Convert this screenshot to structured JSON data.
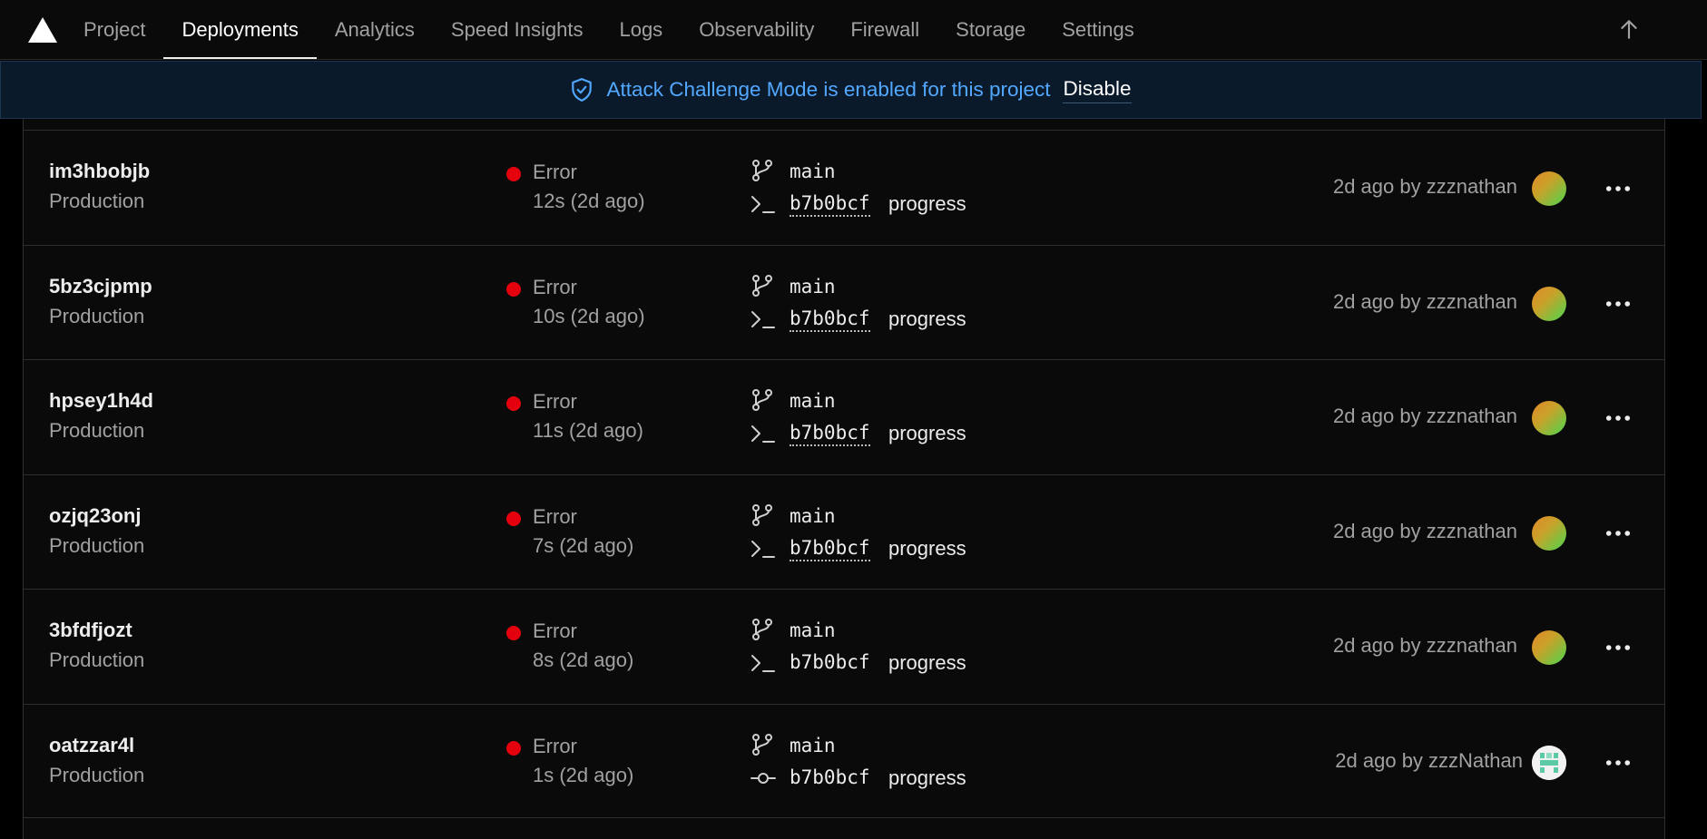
{
  "nav": {
    "tabs": [
      {
        "label": "Project"
      },
      {
        "label": "Deployments"
      },
      {
        "label": "Analytics"
      },
      {
        "label": "Speed Insights"
      },
      {
        "label": "Logs"
      },
      {
        "label": "Observability"
      },
      {
        "label": "Firewall"
      },
      {
        "label": "Storage"
      },
      {
        "label": "Settings"
      }
    ],
    "active_tab": "Deployments",
    "logo_icon": "vercel-triangle-icon",
    "up_icon": "arrow-up-icon"
  },
  "banner": {
    "message": "Attack Challenge Mode is enabled for this project",
    "action": "Disable",
    "icon": "shield-check-icon",
    "accent_color": "#52a8ff"
  },
  "colors": {
    "error_dot": "#e5000e",
    "background": "#0a0a0a",
    "border": "#2e2e2e",
    "muted_text": "#a1a1a1"
  },
  "deployments": [
    {
      "id": "im3hbobjb",
      "env": "Production",
      "status": "Error",
      "duration": "12s (2d ago)",
      "branch": "main",
      "commit": "b7b0bcf",
      "commit_msg": "progress",
      "commit_icon": "terminal-icon",
      "meta": "2d ago by zzznathan",
      "avatar": "gradient-avatar"
    },
    {
      "id": "5bz3cjpmp",
      "env": "Production",
      "status": "Error",
      "duration": "10s (2d ago)",
      "branch": "main",
      "commit": "b7b0bcf",
      "commit_msg": "progress",
      "commit_icon": "terminal-icon",
      "meta": "2d ago by zzznathan",
      "avatar": "gradient-avatar"
    },
    {
      "id": "hpsey1h4d",
      "env": "Production",
      "status": "Error",
      "duration": "11s (2d ago)",
      "branch": "main",
      "commit": "b7b0bcf",
      "commit_msg": "progress",
      "commit_icon": "terminal-icon",
      "meta": "2d ago by zzznathan",
      "avatar": "gradient-avatar"
    },
    {
      "id": "ozjq23onj",
      "env": "Production",
      "status": "Error",
      "duration": "7s (2d ago)",
      "branch": "main",
      "commit": "b7b0bcf",
      "commit_msg": "progress",
      "commit_icon": "terminal-icon",
      "meta": "2d ago by zzznathan",
      "avatar": "gradient-avatar"
    },
    {
      "id": "3bfdfjozt",
      "env": "Production",
      "status": "Error",
      "duration": "8s (2d ago)",
      "branch": "main",
      "commit": "b7b0bcf",
      "commit_msg": "progress",
      "commit_icon": "terminal-icon",
      "meta": "2d ago by zzznathan",
      "avatar": "gradient-avatar"
    },
    {
      "id": "oatzzar4l",
      "env": "Production",
      "status": "Error",
      "duration": "1s (2d ago)",
      "branch": "main",
      "commit": "b7b0bcf",
      "commit_msg": "progress",
      "commit_icon": "git-commit-icon",
      "meta": "2d ago by zzzNathan",
      "avatar": "identicon-avatar"
    }
  ]
}
